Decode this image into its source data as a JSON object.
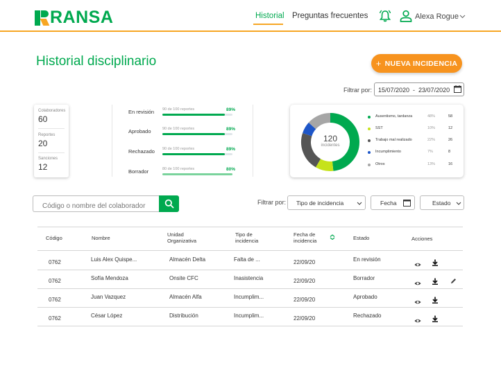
{
  "header": {
    "logo_text": "RANSA",
    "nav": {
      "historial": "Historial",
      "faq": "Preguntas frecuentes"
    },
    "user_name": "Alexa Rogue"
  },
  "page": {
    "title": "Historial disciplinario",
    "new_button": "NUEVA INCIDENCIA",
    "filter_label": "Filtrar por:",
    "date_range": "15/07/2020  -  23/07/2020"
  },
  "stats": [
    {
      "label": "Colaboradores",
      "value": "60"
    },
    {
      "label": "Reportes",
      "value": "20"
    },
    {
      "label": "Sanciones",
      "value": "12"
    }
  ],
  "progress": [
    {
      "label": "En revisión",
      "detail": "90 de 100 reportes",
      "pct": "89%",
      "fraction": 0.89
    },
    {
      "label": "Aprobado",
      "detail": "90 de 100 reportes",
      "pct": "89%",
      "fraction": 0.89
    },
    {
      "label": "Rechazado",
      "detail": "90 de 100 reportes",
      "pct": "89%",
      "fraction": 0.89
    },
    {
      "label": "Borrador",
      "detail": "80 de 100 reportes",
      "pct": "80%",
      "fraction": 1.0
    }
  ],
  "donut": {
    "total": "120",
    "total_label": "incidentes",
    "legend": [
      {
        "name": "Ausentismo, tardanza",
        "pct": "48%",
        "count": "58",
        "color": "#00a94f",
        "value": 58
      },
      {
        "name": "SST",
        "pct": "10%",
        "count": "12",
        "color": "#c6e21a",
        "value": 12
      },
      {
        "name": "Trabajo mal realizado",
        "pct": "22%",
        "count": "26",
        "color": "#555555",
        "value": 26
      },
      {
        "name": "Incumplimiento",
        "pct": "7%",
        "count": "8",
        "color": "#1e56c8",
        "value": 8
      },
      {
        "name": "Otros",
        "pct": "13%",
        "count": "16",
        "color": "#a6a6a6",
        "value": 16
      }
    ]
  },
  "search": {
    "placeholder": "Código o nombre del colaborador"
  },
  "filters": {
    "label": "Filtrar por:",
    "type": "Tipo de incidencia",
    "date": "Fecha",
    "status": "Estado"
  },
  "table": {
    "headers": {
      "code": "Código",
      "name": "Nombre",
      "unit_1": "Unidad",
      "unit_2": "Organizativa",
      "type_1": "Tipo de",
      "type_2": "incidencia",
      "date_1": "Fecha de",
      "date_2": "incidencia",
      "status": "Estado",
      "actions": "Acciones"
    },
    "rows": [
      {
        "code": "0762",
        "name": "Luis Alex Quispe...",
        "unit": "Almacén Delta",
        "type": "Falta de ...",
        "date": "22/09/20",
        "status": "En revisión"
      },
      {
        "code": "0762",
        "name": "Sofía Mendoza",
        "unit": "Onsite CFC",
        "type": "Inasistencia",
        "date": "22/09/20",
        "status": "Borrador"
      },
      {
        "code": "0762",
        "name": "Juan Vazquez",
        "unit": "Almacén Alfa",
        "type": "Incumplim...",
        "date": "22/09/20",
        "status": "Aprobado"
      },
      {
        "code": "0762",
        "name": "César López",
        "unit": "Distribución",
        "type": "Incumplim...",
        "date": "22/09/20",
        "status": "Rechazado"
      }
    ]
  },
  "colors": {
    "primary": "#00a94f",
    "accent": "#f7931e",
    "header_line": "#f7a623"
  }
}
